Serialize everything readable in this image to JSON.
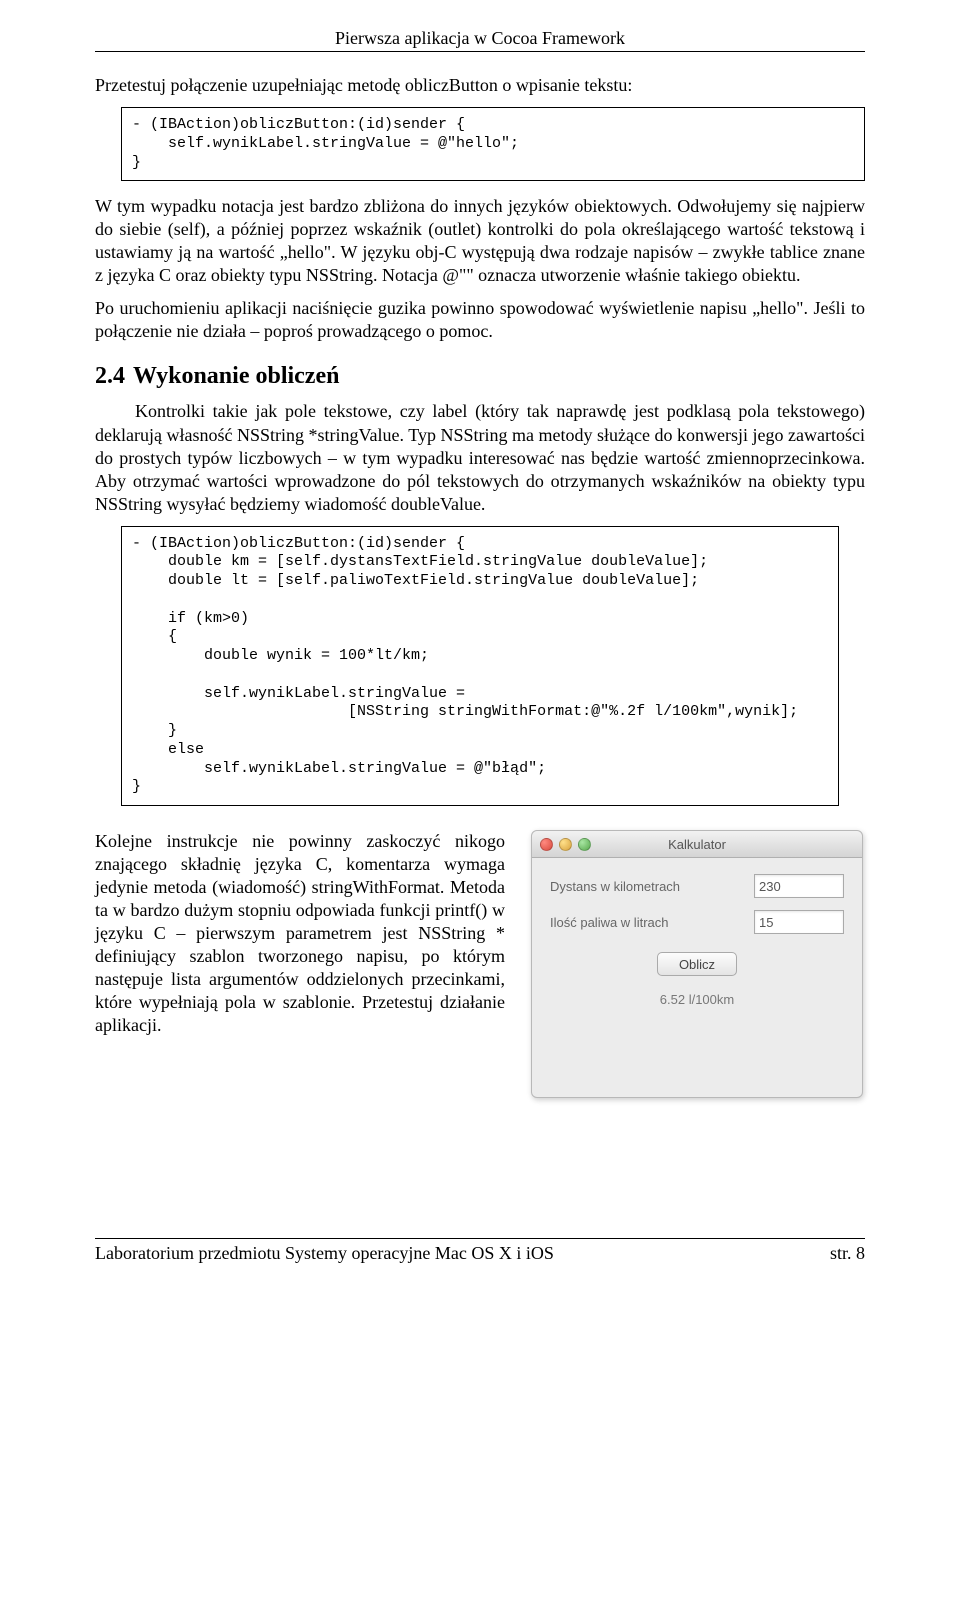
{
  "header": "Pierwsza aplikacja w Cocoa Framework",
  "intro_para": "Przetestuj połączenie uzupełniając metodę obliczButton o wpisanie tekstu:",
  "code1": "- (IBAction)obliczButton:(id)sender {\n    self.wynikLabel.stringValue = @\"hello\";\n}",
  "para1": "W tym wypadku notacja jest bardzo zbliżona do innych języków obiektowych. Odwołujemy się najpierw do siebie (self), a później poprzez wskaźnik (outlet) kontrolki do pola określającego wartość tekstową i ustawiamy ją na wartość „hello\". W języku obj-C występują dwa rodzaje napisów – zwykłe tablice znane z języka C oraz obiekty typu NSString. Notacja @\"\" oznacza utworzenie właśnie takiego obiektu.",
  "para2": "Po uruchomieniu aplikacji naciśnięcie guzika powinno spowodować wyświetlenie napisu „hello\". Jeśli to połączenie nie działa – poproś prowadzącego o pomoc.",
  "section": {
    "num": "2.4",
    "title": "Wykonanie obliczeń"
  },
  "para3": "Kontrolki takie jak pole tekstowe, czy label (który tak naprawdę jest podklasą pola tekstowego) deklarują własność NSString *stringValue. Typ NSString ma metody służące do konwersji jego zawartości do prostych typów liczbowych – w tym wypadku interesować nas będzie wartość zmiennoprzecinkowa. Aby otrzymać wartości wprowadzone do pól tekstowych do otrzymanych wskaźników na obiekty typu NSString wysyłać będziemy wiadomość doubleValue.",
  "code2": "- (IBAction)obliczButton:(id)sender {\n    double km = [self.dystansTextField.stringValue doubleValue];\n    double lt = [self.paliwoTextField.stringValue doubleValue];\n\n    if (km>0)\n    {\n        double wynik = 100*lt/km;\n\n        self.wynikLabel.stringValue =\n                        [NSString stringWithFormat:@\"%.2f l/100km\",wynik];\n    }\n    else\n        self.wynikLabel.stringValue = @\"błąd\";\n}",
  "para4": "Kolejne instrukcje nie powinny zaskoczyć nikogo znającego składnię języka C, komentarza wymaga jedynie metoda (wiadomość) stringWithFormat. Metoda ta w bardzo dużym stopniu odpowiada funkcji printf() w języku C – pierwszym parametrem jest NSString * definiujący szablon tworzonego napisu, po którym następuje lista argumentów oddzielonych przecinkami, które wypełniają pola w szablonie. Przetestuj działanie aplikacji.",
  "window": {
    "title": "Kalkulator",
    "row1_label": "Dystans w kilometrach",
    "row1_value": "230",
    "row2_label": "Ilość paliwa w litrach",
    "row2_value": "15",
    "button": "Oblicz",
    "result": "6.52 l/100km"
  },
  "footer_left": "Laboratorium przedmiotu Systemy operacyjne Mac OS X i iOS",
  "footer_right": "str. 8"
}
